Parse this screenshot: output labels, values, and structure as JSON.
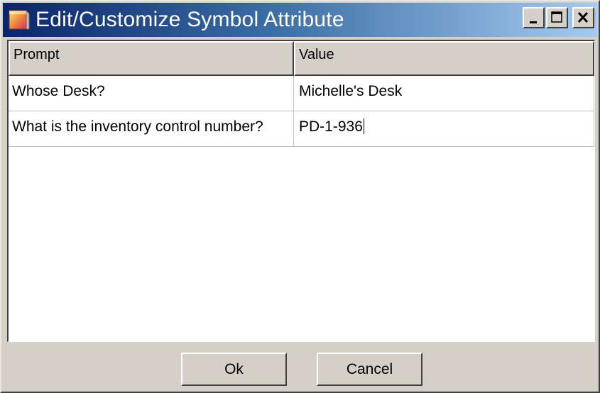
{
  "window": {
    "title": "Edit/Customize Symbol Attribute",
    "app_icon": "symbol-attribute-icon",
    "controls": {
      "minimize_icon": "minimize-icon",
      "maximize_icon": "maximize-icon",
      "close_icon": "close-icon"
    }
  },
  "grid": {
    "columns": [
      "Prompt",
      "Value"
    ],
    "rows": [
      {
        "prompt": "Whose Desk?",
        "value": "Michelle's Desk"
      },
      {
        "prompt": "What is the inventory control number?",
        "value": "PD-1-936"
      }
    ]
  },
  "buttons": {
    "ok_label": "Ok",
    "cancel_label": "Cancel"
  },
  "colors": {
    "titlebar_start": "#0a246a",
    "titlebar_end": "#a6caf0",
    "face": "#d4d0c8"
  }
}
